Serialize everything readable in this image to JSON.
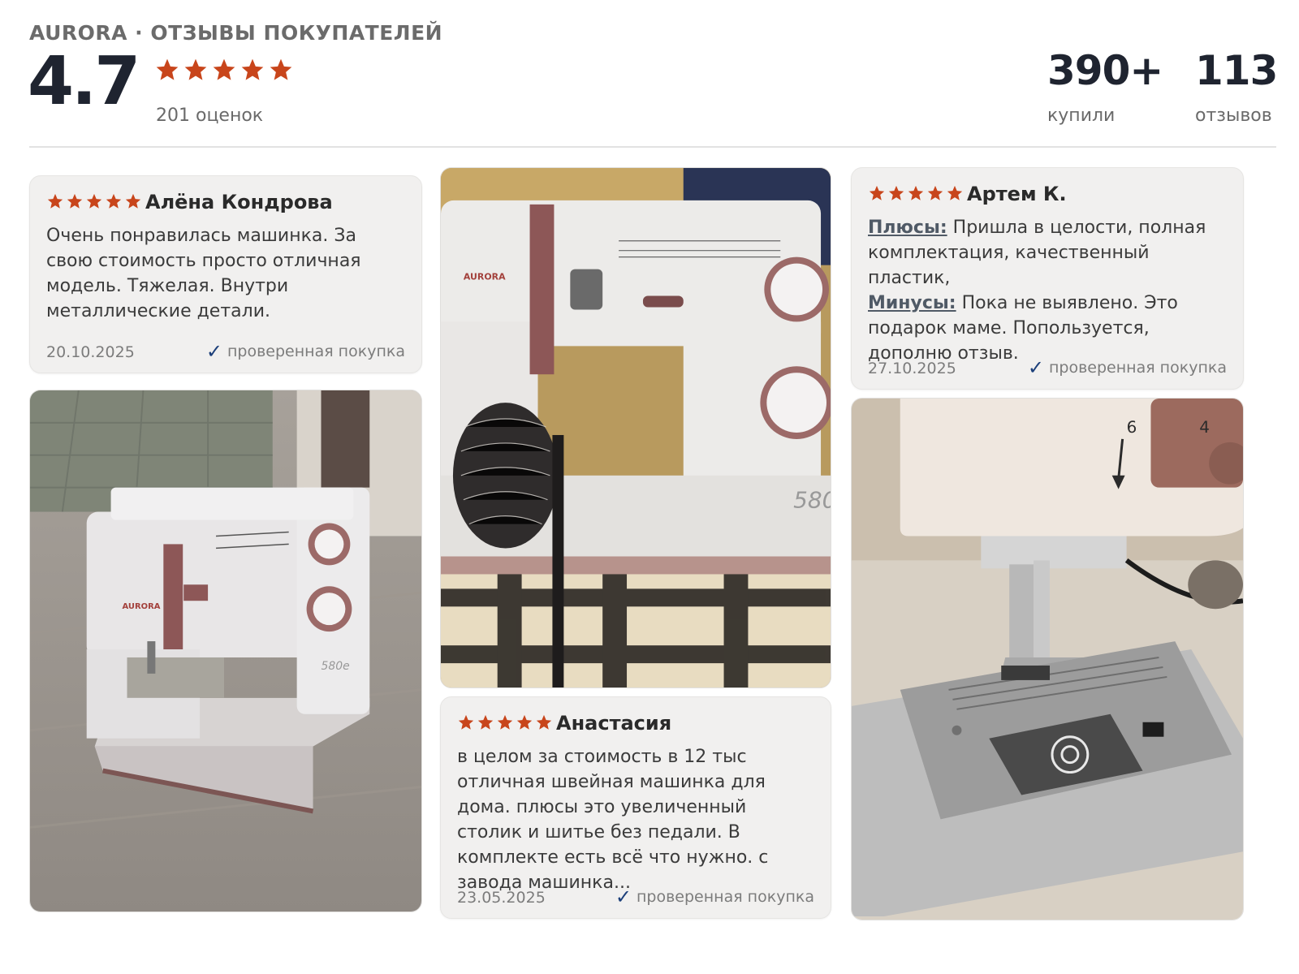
{
  "header": {
    "caption": "AURORA · ОТЗЫВЫ ПОКУПАТЕЛЕЙ",
    "rating": "4.7",
    "rating_count": "201 оценок",
    "stars": 5
  },
  "stats": {
    "bought_value": "390+",
    "bought_label": "купили",
    "reviews_value": "113",
    "reviews_label": "отзывов"
  },
  "reviews": [
    {
      "author": "Алёна Кондрова",
      "text": "Очень понравилась машинка. За свою стоимость просто отличная модель. Тяжелая. Внутри металлические детали.",
      "date": "20.10.2025",
      "verified": "проверенная покупка",
      "stars": 5
    },
    {
      "author": "Анастасия",
      "text": "в целом за стоимость в 12 тыс отличная швейная машинка для дома. плюсы это увеличенный столик и шитье без педали. В комплекте есть всё что нужно. с завода машинка...",
      "date": "23.05.2025",
      "verified": "проверенная покупка",
      "stars": 5
    },
    {
      "author": "Артем К.",
      "pros_label": "Плюсы:",
      "pros_text": " Пришла в целости, полная комплектация, качественный пластик,",
      "cons_label": "Минусы:",
      "cons_text": " Пока не выявлено. Это подарок маме. Попользуется, дополню отзыв.",
      "date": "27.10.2025",
      "verified": "проверенная покупка",
      "stars": 5
    }
  ],
  "photos": [
    {
      "name": "photo-sewing-machine-floor",
      "brand": "AURORA",
      "model": "580e"
    },
    {
      "name": "photo-sewing-machine-table",
      "brand": "AURORA",
      "model": "580"
    },
    {
      "name": "photo-needle-plate-closeup",
      "dial_marks": [
        "6",
        "4"
      ]
    }
  ],
  "colors": {
    "star": "#c8451b",
    "brand_text": "#1f2430",
    "card_bg": "#f1f0ef",
    "verified_check": "#1c3f7a"
  },
  "icons": [
    "star-icon",
    "check-icon"
  ]
}
